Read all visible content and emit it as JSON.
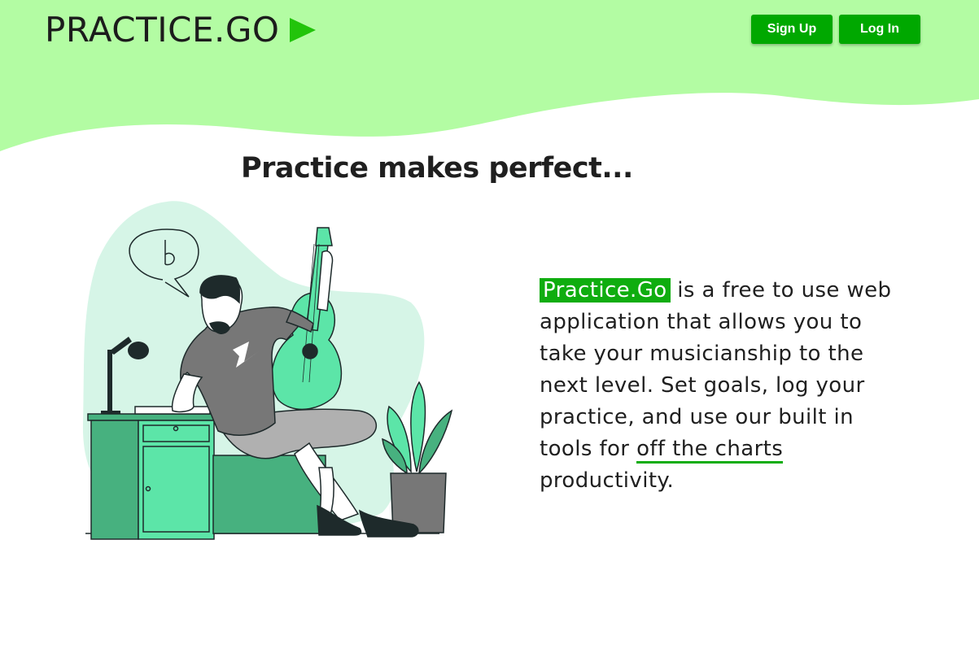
{
  "header": {
    "logo_text": "PRACTICE.GO",
    "logo_icon": "play-icon",
    "signup_label": "Sign Up",
    "login_label": "Log In"
  },
  "hero": {
    "headline": "Practice makes perfect...",
    "illustration": "musician-illustration"
  },
  "description": {
    "brand": "Practice.Go",
    "text_before_link": " is a free to use web application that allows you to take your musicianship to the next level. Set goals, log your practice, and use our built in tools for ",
    "link_text": "off the charts",
    "text_after_link": " productivity."
  },
  "colors": {
    "header_background": "#b3fca3",
    "button_background": "#00a800",
    "brand_highlight": "#0fad0f",
    "illustration_green": "#5ce5a8",
    "illustration_dark_green": "#47b17f"
  }
}
